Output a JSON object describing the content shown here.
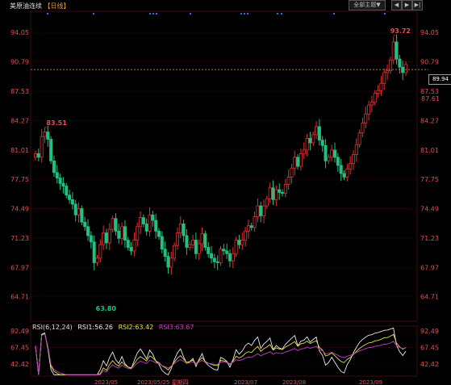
{
  "header": {
    "instrument": "美原油连续",
    "period_tag": "【日线】",
    "indicator_button": "全部主题▼",
    "nav_prev": "◀",
    "nav_next": "▶",
    "nav_end": "▶|"
  },
  "colors": {
    "up": "#e03030",
    "down": "#20c080",
    "grid": "#3a1010",
    "ref_line": "#e0a040",
    "rsi1": "#e8e8e8",
    "rsi2": "#e0e040",
    "rsi3": "#c040c0",
    "axis_text": "#e05050"
  },
  "current_price": "89.94",
  "rsi_legend": {
    "name": "RSI(6,12,24)",
    "rsi1": "RSI1:56.26",
    "rsi2": "RSI2:63.42",
    "rsi3": "RSI3:63.67"
  },
  "bottom_left": "",
  "x_labels": [
    "2023/05",
    "2023/05/25 星期四",
    "2023/07",
    "2023/08",
    "2023/09"
  ],
  "chart_data": {
    "type": "candlestick",
    "y_ticks": [
      94.05,
      90.79,
      87.53,
      84.27,
      81.01,
      77.75,
      74.49,
      71.23,
      67.97,
      64.71
    ],
    "ylim": [
      62.0,
      96.4
    ],
    "annotations": [
      {
        "label": "83.51",
        "value": 83.51,
        "index": 3
      },
      {
        "label": "63.80",
        "value": 63.8,
        "index": 19
      },
      {
        "label": "93.72",
        "value": 93.72,
        "index": 116
      }
    ],
    "candles_close": [
      80.6,
      80.2,
      82.5,
      83.0,
      82.2,
      79.8,
      78.5,
      77.9,
      77.3,
      77.0,
      76.0,
      75.5,
      75.0,
      73.8,
      74.5,
      73.0,
      72.5,
      71.5,
      70.8,
      68.5,
      69.0,
      70.5,
      71.8,
      70.7,
      72.2,
      73.4,
      72.0,
      71.2,
      72.5,
      71.0,
      70.2,
      69.8,
      71.0,
      72.5,
      73.5,
      72.8,
      72.0,
      73.8,
      73.2,
      72.0,
      71.4,
      70.0,
      69.2,
      68.0,
      69.0,
      70.4,
      71.8,
      72.8,
      71.5,
      70.2,
      70.5,
      71.0,
      69.5,
      70.6,
      71.7,
      70.2,
      69.5,
      69.0,
      68.6,
      68.5,
      70.0,
      69.8,
      69.5,
      68.7,
      69.5,
      71.0,
      70.5,
      71.0,
      72.0,
      72.6,
      72.4,
      73.6,
      74.8,
      73.7,
      74.8,
      75.6,
      76.8,
      75.5,
      76.6,
      76.3,
      76.2,
      77.2,
      78.0,
      79.0,
      80.2,
      79.2,
      80.6,
      81.0,
      82.3,
      81.8,
      82.7,
      83.6,
      82.1,
      81.5,
      79.8,
      80.2,
      81.0,
      80.2,
      79.3,
      78.4,
      78.0,
      78.9,
      79.5,
      80.5,
      81.6,
      82.9,
      84.0,
      85.0,
      86.0,
      86.3,
      87.3,
      87.6,
      88.4,
      89.6,
      89.8,
      91.0,
      93.0,
      91.1,
      90.2,
      89.6,
      90.5
    ],
    "rsi": {
      "yticks": [
        92.49,
        67.45,
        42.42
      ],
      "ylim": [
        24.0,
        100.0
      ]
    }
  }
}
